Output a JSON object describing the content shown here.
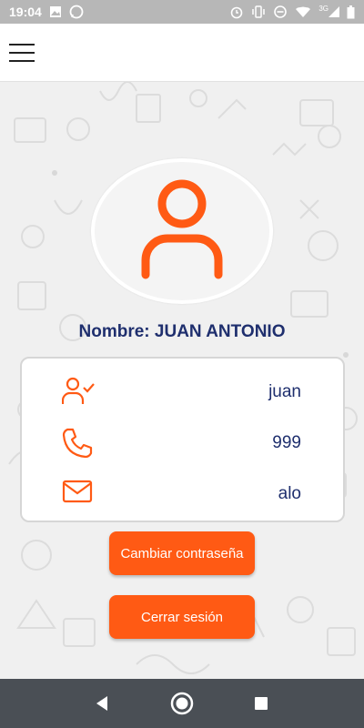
{
  "status_bar": {
    "time": "19:04",
    "network": "3G",
    "icons_left": [
      "image-icon",
      "whatsapp-icon"
    ],
    "icons_right": [
      "alarm-icon",
      "vibrate-icon",
      "do-not-disturb-icon",
      "wifi-icon",
      "signal-icon",
      "battery-icon"
    ]
  },
  "app_bar": {
    "menu_icon": "hamburger-menu-icon"
  },
  "profile": {
    "name_label": "Nombre: JUAN ANTONIO",
    "avatar_icon": "user-avatar-icon"
  },
  "info": {
    "rows": [
      {
        "icon": "user-check-icon",
        "value": "juan"
      },
      {
        "icon": "phone-icon",
        "value": "999"
      },
      {
        "icon": "mail-icon",
        "value": "alo"
      }
    ]
  },
  "buttons": {
    "change_password": "Cambiar contraseña",
    "logout": "Cerrar sesión"
  },
  "nav": {
    "back": "back-icon",
    "home": "home-icon",
    "recents": "recents-icon"
  },
  "colors": {
    "accent": "#ff5a14",
    "text_primary": "#1f2f6e",
    "status_bar": "#b7b7b7",
    "nav_bar": "#4a4f55"
  }
}
